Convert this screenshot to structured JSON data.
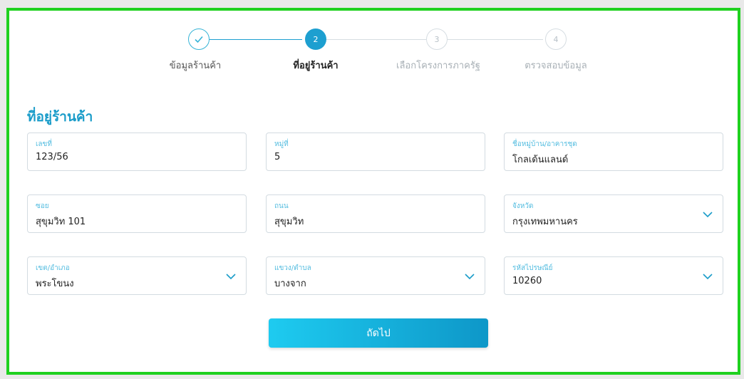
{
  "stepper": {
    "steps": [
      {
        "number": "",
        "label": "ข้อมูลร้านค้า",
        "state": "done"
      },
      {
        "number": "2",
        "label": "ที่อยู่ร้านค้า",
        "state": "active"
      },
      {
        "number": "3",
        "label": "เลือกโครงการภาครัฐ",
        "state": "pending"
      },
      {
        "number": "4",
        "label": "ตรวจสอบข้อมูล",
        "state": "pending"
      }
    ]
  },
  "section_title": "ที่อยู่ร้านค้า",
  "fields": {
    "house_no": {
      "label": "เลขที่",
      "value": "123/56"
    },
    "moo": {
      "label": "หมู่ที่",
      "value": "5"
    },
    "village": {
      "label": "ชื่อหมู่บ้าน/อาคารชุด",
      "value": "โกลเด้นแลนด์"
    },
    "soi": {
      "label": "ซอย",
      "value": "สุขุมวิท 101"
    },
    "road": {
      "label": "ถนน",
      "value": "สุขุมวิท"
    },
    "province": {
      "label": "จังหวัด",
      "value": "กรุงเทพมหานคร"
    },
    "district": {
      "label": "เขต/อำเภอ",
      "value": "พระโขนง"
    },
    "subdistrict": {
      "label": "แขวง/ตำบล",
      "value": "บางจาก"
    },
    "postcode": {
      "label": "รหัสไปรษณีย์",
      "value": "10260"
    }
  },
  "next_label": "ถัดไป",
  "colors": {
    "accent": "#1a9cc9",
    "active_step": "#1d9fd0",
    "frame_border": "#1fd11f",
    "button_gradient_start": "#1ecbf0",
    "button_gradient_end": "#0e97c8"
  }
}
